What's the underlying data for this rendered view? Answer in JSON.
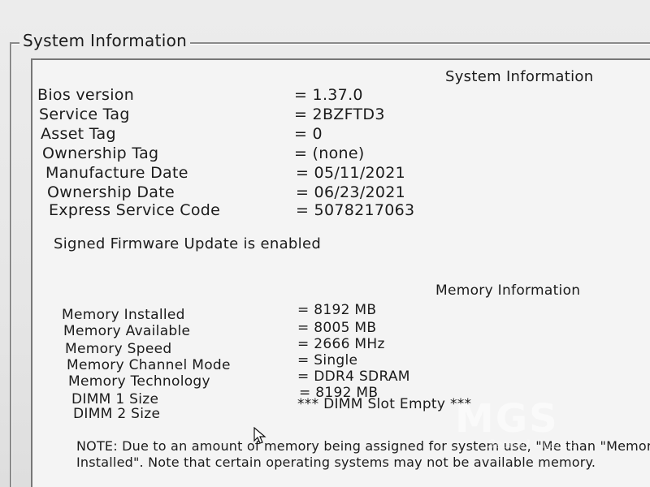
{
  "window": {
    "group_title": "System Information"
  },
  "system": {
    "heading": "System Information",
    "rows": [
      {
        "label": "Bios version",
        "value": "= 1.37.0"
      },
      {
        "label": "Service Tag",
        "value": "= 2BZFTD3"
      },
      {
        "label": "Asset Tag",
        "value": "= 0"
      },
      {
        "label": "Ownership Tag",
        "value": "= (none)"
      },
      {
        "label": "Manufacture Date",
        "value": "= 05/11/2021"
      },
      {
        "label": "Ownership Date",
        "value": "= 06/23/2021"
      },
      {
        "label": "Express Service Code",
        "value": "= 5078217063"
      }
    ],
    "firmware_status": "Signed Firmware Update is enabled"
  },
  "memory": {
    "heading": "Memory Information",
    "rows": [
      {
        "label": "Memory Installed",
        "value": "= 8192 MB"
      },
      {
        "label": "Memory Available",
        "value": "= 8005 MB"
      },
      {
        "label": "Memory Speed",
        "value": "= 2666 MHz"
      },
      {
        "label": "Memory Channel Mode",
        "value": "= Single"
      },
      {
        "label": "Memory Technology",
        "value": "= DDR4 SDRAM"
      },
      {
        "label": "DIMM 1 Size",
        "value": "= 8192 MB"
      },
      {
        "label": "DIMM 2 Size",
        "value": "*** DIMM Slot Empty ***"
      }
    ],
    "note": "NOTE: Due to an amount of memory being assigned for system use, \"Me than \"Memory Installed\". Note that certain operating systems may not be available memory."
  },
  "watermark": {
    "logo": "MGS",
    "tagline": "Second Chance"
  },
  "icons": {
    "cursor": "mouse-pointer-icon"
  }
}
